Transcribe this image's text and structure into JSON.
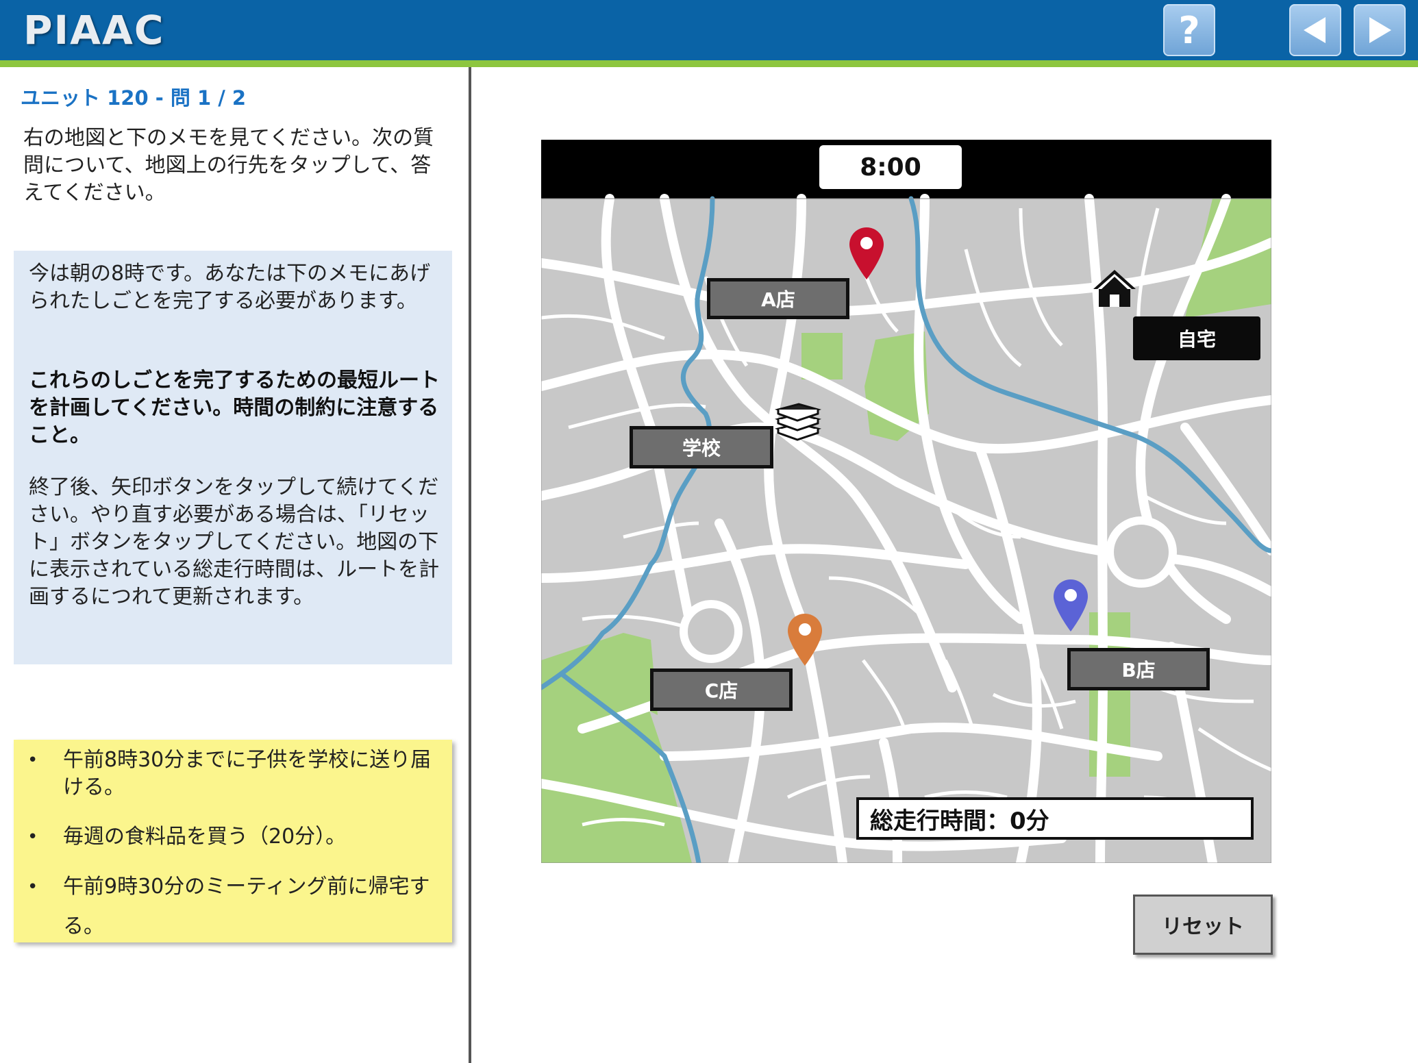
{
  "header": {
    "logo": "PIAAC",
    "help_label": "?",
    "icons": {
      "help": "help-icon",
      "back": "back-arrow-icon",
      "next": "next-arrow-icon"
    },
    "colors": {
      "bar": "#0a63a6",
      "accent": "#8dc63f"
    }
  },
  "left_panel": {
    "unit_title": "ユニット 120 - 問 1 / 2",
    "instruction": "右の地図と下のメモを見てください。次の質問について、地図上の行先をタップして、答えてください。",
    "task_box": {
      "paragraph1": "今は朝の8時です。あなたは下のメモにあげられたしごとを完了する必要があります。",
      "paragraph2": "これらのしごとを完了するための最短ルートを計画してください。時間の制約に注意すること。",
      "paragraph3": "終了後、矢印ボタンをタップして続けてください。やり直す必要がある場合は、「リセット」ボタンをタップしてください。地図の下に表示されている総走行時間は、ルートを計画するにつれて更新されます。"
    },
    "memo": [
      "午前8時30分までに子供を学校に送り届ける。",
      "毎週の食料品を買う（20分）。",
      "午前9時30分のミーティング前に帰宅する。"
    ]
  },
  "map": {
    "time": "8:00",
    "labels": {
      "store_a": "A店",
      "school": "学校",
      "home": "自宅",
      "store_b": "B店",
      "store_c": "C店"
    },
    "total_travel_time": "総走行時間：0分",
    "pin_colors": {
      "store_a": "#c8102e",
      "store_b": "#5b63d6",
      "store_c": "#d97c3b"
    },
    "icons": {
      "home": "house-icon",
      "school": "books-icon"
    }
  },
  "reset_label": "リセット"
}
